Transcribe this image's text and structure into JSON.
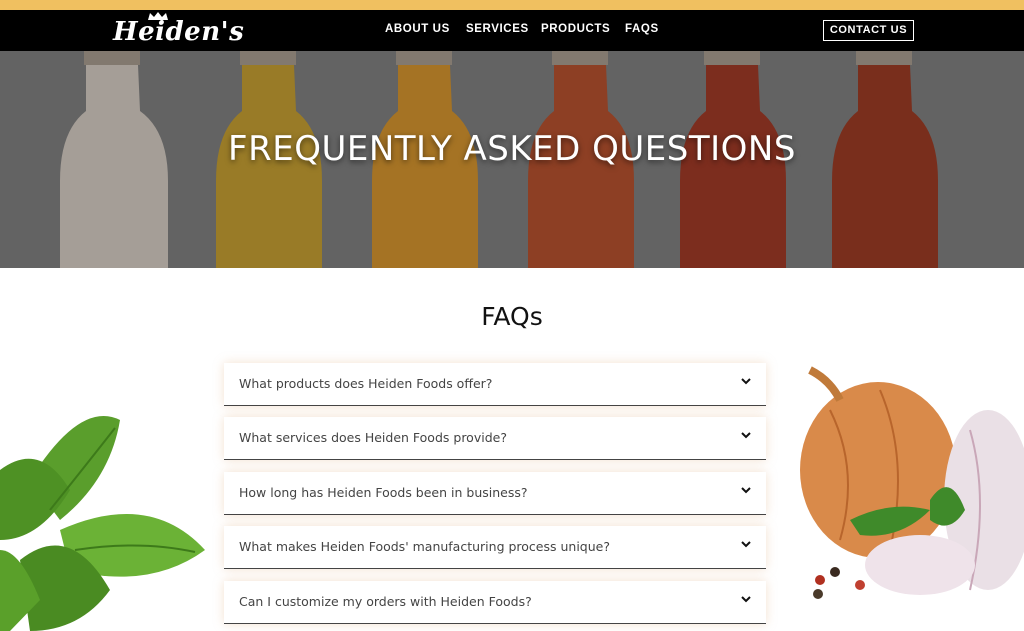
{
  "brand": {
    "logo_text": "Heiden's"
  },
  "nav": {
    "about": "ABOUT US",
    "services": "SERVICES",
    "products": "PRODUCTS",
    "faqs": "FAQS",
    "contact": "CONTACT US"
  },
  "hero": {
    "title": "FREQUENTLY ASKED QUESTIONS"
  },
  "faq": {
    "heading": "FAQs",
    "items": [
      {
        "question": "What products does Heiden Foods offer?"
      },
      {
        "question": "What services does Heiden Foods provide?"
      },
      {
        "question": "How long has Heiden Foods been in business?"
      },
      {
        "question": "What makes Heiden Foods' manufacturing process unique?"
      },
      {
        "question": "Can I customize my orders with Heiden Foods?"
      }
    ]
  },
  "icons": {
    "accordion": "chevron-down-icon",
    "logo": "crown-icon"
  },
  "colors": {
    "accent_bar": "#f0c060",
    "navbar": "#000000",
    "faq_text": "#444444"
  }
}
